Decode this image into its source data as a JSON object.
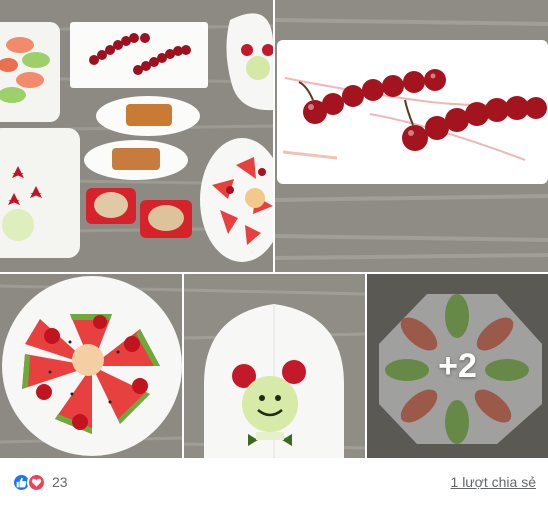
{
  "post": {
    "photos": [
      {
        "name": "photo-fruit-collage",
        "alt": "Fruit platter collage"
      },
      {
        "name": "photo-cherry-caterpillar",
        "alt": "Cherry caterpillar plate"
      },
      {
        "name": "photo-watermelon-flower",
        "alt": "Watermelon flower plate"
      },
      {
        "name": "photo-frog-face",
        "alt": "Frog face plate"
      },
      {
        "name": "photo-guava-flower",
        "alt": "Guava flower plate"
      }
    ],
    "more_photos_label": "+2"
  },
  "reactions": {
    "icons": [
      "like-icon",
      "love-icon"
    ],
    "colors": {
      "like": "#1877f2",
      "love": "#f33e58"
    },
    "count": "23"
  },
  "shares": {
    "label": "1 lượt chia sẻ"
  }
}
